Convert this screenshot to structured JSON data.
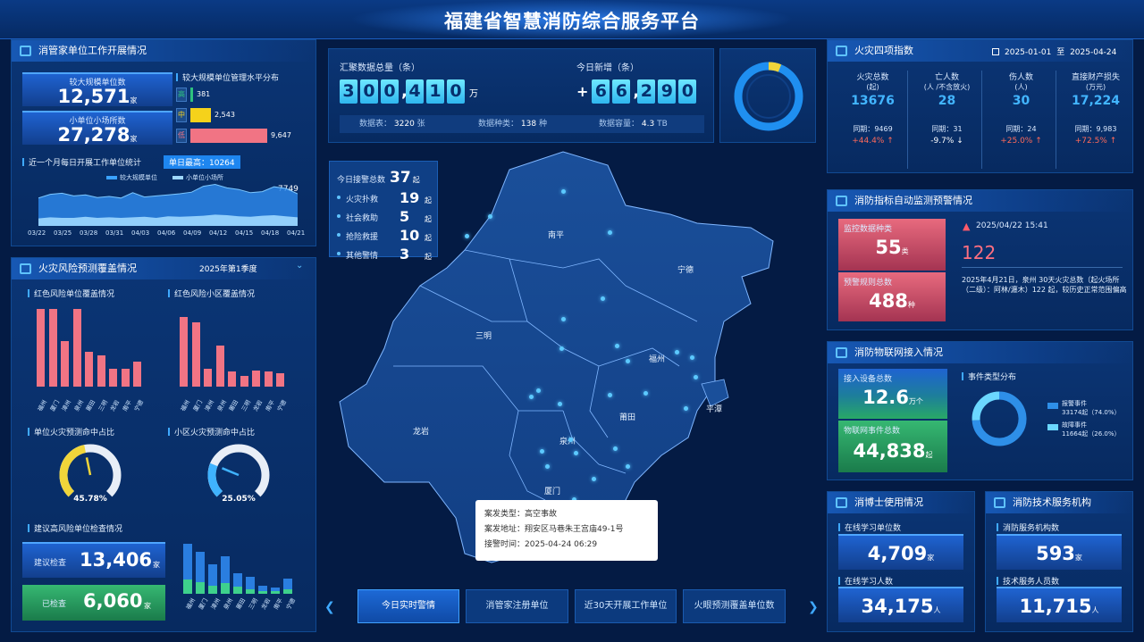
{
  "header": {
    "title": "福建省智慧消防综合服务平台"
  },
  "work": {
    "title": "消管家单位工作开展情况",
    "large_label": "较大规模单位数",
    "large_value": "12,571",
    "large_unit": "家",
    "small_label": "小单位小场所数",
    "small_value": "27,278",
    "small_unit": "家",
    "level_title": "较大规模单位管理水平分布",
    "levels": [
      {
        "name": "高",
        "value": "381",
        "num": 381,
        "color": "#2ec27e"
      },
      {
        "name": "中",
        "value": "2,543",
        "num": 2543,
        "color": "#f5d21b"
      },
      {
        "name": "低",
        "value": "9,647",
        "num": 9647,
        "color": "#f17484"
      }
    ],
    "daily_title": "近一个月每日开展工作单位统计",
    "daily_max": "单日最高：10264",
    "legend_large": "较大规模单位",
    "legend_small": "小单位小场所",
    "max_label": "7749",
    "dates": [
      "03/22",
      "03/25",
      "03/28",
      "03/31",
      "04/03",
      "04/06",
      "04/09",
      "04/12",
      "04/15",
      "04/18",
      "04/21"
    ],
    "area_large": [
      5200,
      5900,
      6100,
      5600,
      5800,
      5300,
      5500,
      5200,
      6200,
      5400,
      5600,
      5800,
      6000,
      6300,
      7400,
      7749,
      7100,
      6800,
      6200,
      6400,
      7300,
      7000,
      6000
    ],
    "area_small": [
      1400,
      1600,
      1500,
      1500,
      1700,
      1500,
      1600,
      1500,
      1600,
      1700,
      1500,
      1800,
      1700,
      1800,
      1900,
      2100,
      2000,
      1800,
      1700,
      1900,
      2000,
      1800,
      1600
    ]
  },
  "risk": {
    "title": "火灾风险预测覆盖情况",
    "season": "2025年第1季度",
    "red_unit_title": "红色风险单位覆盖情况",
    "red_area_title": "红色风险小区覆盖情况",
    "cities": [
      "福州",
      "厦门",
      "漳州",
      "泉州",
      "莆田",
      "三明",
      "龙岩",
      "南平",
      "宁德"
    ],
    "red_units": [
      95,
      95,
      55,
      95,
      42,
      38,
      22,
      22,
      30
    ],
    "red_areas": [
      85,
      78,
      22,
      50,
      18,
      13,
      20,
      18,
      16
    ],
    "unit_ratio_title": "单位火灾预测命中占比",
    "unit_ratio": "45.78%",
    "unit_ratio_num": 45.78,
    "area_ratio_title": "小区火灾预测命中占比",
    "area_ratio": "25.05%",
    "area_ratio_num": 25.05,
    "check_title": "建议高风险单位检查情况",
    "suggest_label": "建议检查",
    "suggest_value": "13,406",
    "suggest_unit": "家",
    "checked_label": "已检查",
    "checked_value": "6,060",
    "checked_unit": "家",
    "check_blue": [
      60,
      50,
      35,
      45,
      25,
      20,
      10,
      8,
      18
    ],
    "check_green": [
      38,
      32,
      22,
      28,
      18,
      12,
      8,
      6,
      12
    ]
  },
  "aggregate": {
    "total_label": "汇聚数据总量（条）",
    "total_digits": [
      "3",
      "0",
      "0",
      "4",
      "1",
      "0"
    ],
    "total_unit": "万",
    "today_label": "今日新增（条）",
    "today_sign": "+",
    "today_digits": [
      "6",
      "6",
      "2",
      "9",
      "0"
    ],
    "tables_label": "数据表：",
    "tables_value": "3220",
    "tables_unit": "张",
    "kinds_label": "数据种类：",
    "kinds_value": "138",
    "kinds_unit": "种",
    "cap_label": "数据容量：",
    "cap_value": "4.3",
    "cap_unit": "TB",
    "ring_ratio": 0.06
  },
  "alarm": {
    "total_label": "今日接警总数",
    "total_value": "37",
    "unit": "起",
    "items": [
      {
        "label": "火灾扑救",
        "value": "19"
      },
      {
        "label": "社会救助",
        "value": "5"
      },
      {
        "label": "抢险救援",
        "value": "10"
      },
      {
        "label": "其他警情",
        "value": "3"
      }
    ]
  },
  "map": {
    "cities": [
      {
        "name": "南平"
      },
      {
        "name": "宁德"
      },
      {
        "name": "三明"
      },
      {
        "name": "福州"
      },
      {
        "name": "莆田"
      },
      {
        "name": "泉州"
      },
      {
        "name": "龙岩"
      },
      {
        "name": "厦门"
      },
      {
        "name": "平潭"
      }
    ],
    "popup": {
      "type_label": "案发类型：",
      "type_value": "高空事故",
      "addr_label": "案发地址：",
      "addr_value": "翔安区马巷朱王宫庙49-1号",
      "time_label": "接警时间：",
      "time_value": "2025-04-24 06:29"
    }
  },
  "tabs": [
    {
      "label": "今日实时警情"
    },
    {
      "label": "消管家注册单位"
    },
    {
      "label": "近30天开展工作单位"
    },
    {
      "label": "火眼预测覆盖单位数"
    }
  ],
  "fire4": {
    "title": "火灾四项指数",
    "start": "2025-01-01",
    "to": "至",
    "end": "2025-04-24",
    "cols": [
      {
        "title": "火灾总数",
        "sub": "(起)",
        "value": "13676",
        "yoy_label": "同期：",
        "yoy_value": "9469",
        "change": "+44.4% ↑",
        "up": true
      },
      {
        "title": "亡人数",
        "sub": "(人 /不含放火)",
        "value": "28",
        "yoy_label": "同期：",
        "yoy_value": "31",
        "change": "-9.7% ↓",
        "up": false
      },
      {
        "title": "伤人数",
        "sub": "(人)",
        "value": "30",
        "yoy_label": "同期：",
        "yoy_value": "24",
        "change": "+25.0% ↑",
        "up": true
      },
      {
        "title": "直接财产损失",
        "sub": "(万元)",
        "value": "17,224",
        "yoy_label": "同期：",
        "yoy_value": "9,983",
        "change": "+72.5% ↑",
        "up": true
      }
    ]
  },
  "monitor": {
    "title": "消防指标自动监测预警情况",
    "kinds_label": "监控数据种类",
    "kinds_value": "55",
    "kinds_unit": "类",
    "rules_label": "预警规则总数",
    "rules_value": "488",
    "rules_unit": "种",
    "alert_time": "2025/04/22 15:41",
    "alert_value": "122",
    "alert_text": "2025年4月21日，泉州 30天火灾总数（起火场所（二级）：阿林/瀍木）122 起，较历史正常范围偏高"
  },
  "iot": {
    "title": "消防物联网接入情况",
    "devices_label": "接入设备总数",
    "devices_value": "12.6",
    "devices_unit": "万个",
    "events_label": "物联网事件总数",
    "events_value": "44,838",
    "events_unit": "起",
    "dist_title": "事件类型分布",
    "legend": [
      {
        "name": "报警事件",
        "detail": "33174起（74.0%）",
        "pct": 74.0,
        "color": "#2e8fe8"
      },
      {
        "name": "故障事件",
        "detail": "11664起（26.0%）",
        "pct": 26.0,
        "color": "#6bd7ff"
      }
    ]
  },
  "doctor": {
    "title": "消博士使用情况",
    "units_label": "在线学习单位数",
    "units_value": "4,709",
    "units_unit": "家",
    "people_label": "在线学习人数",
    "people_value": "34,175",
    "people_unit": "人"
  },
  "tech": {
    "title": "消防技术服务机构",
    "orgs_label": "消防服务机构数",
    "orgs_value": "593",
    "orgs_unit": "家",
    "staff_label": "技术服务人员数",
    "staff_value": "11,715",
    "staff_unit": "人"
  }
}
